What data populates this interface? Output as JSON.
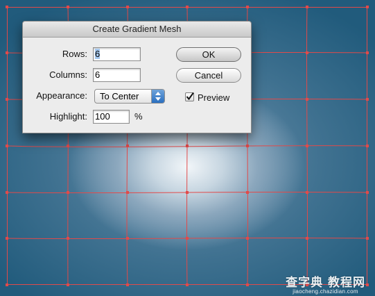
{
  "dialog": {
    "title": "Create Gradient Mesh",
    "rows_label": "Rows:",
    "rows_value": "6",
    "columns_label": "Columns:",
    "columns_value": "6",
    "appearance_label": "Appearance:",
    "appearance_value": "To Center",
    "highlight_label": "Highlight:",
    "highlight_value": "100",
    "percent_sign": "%",
    "ok_label": "OK",
    "cancel_label": "Cancel",
    "preview_label": "Preview",
    "preview_checked": true
  },
  "mesh": {
    "rows": 6,
    "columns": 6,
    "line_color": "#e24a4a",
    "center_color": "#f2f6f9",
    "edge_color": "#215b7c"
  },
  "watermark": {
    "text": "查字典 教程网",
    "subtext": "jiaocheng.chazidian.com"
  }
}
